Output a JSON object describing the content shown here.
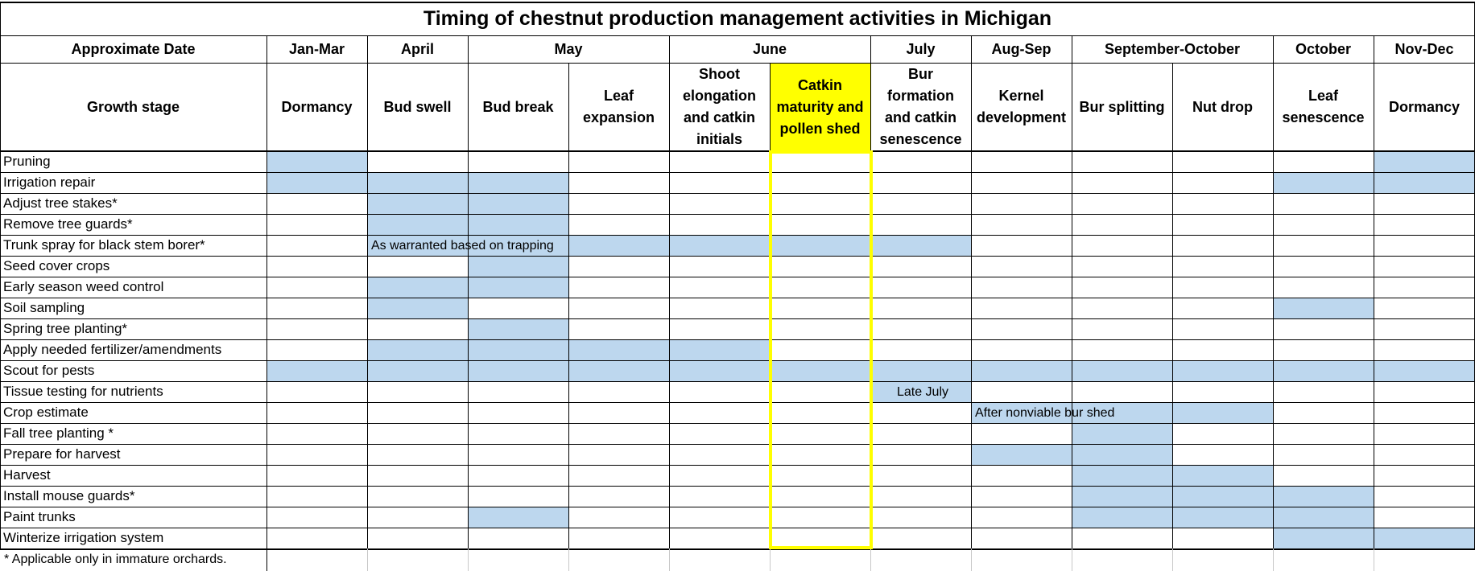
{
  "sheet_title": "Timing of chestnut production management activities in Michigan",
  "date_header": "Approximate Date",
  "dates": [
    "Jan-Mar",
    "April",
    "May",
    "June",
    "July",
    "Aug-Sep",
    "September-October",
    "October",
    "Nov-Dec"
  ],
  "stage_header": "Growth stage",
  "stages": [
    "Dormancy",
    "Bud swell",
    "Bud break",
    "Leaf\nexpansion",
    "Shoot\nelongation\nand catkin\ninitials",
    "Catkin\nmaturity and\npollen shed",
    "Bur\nformation\nand catkin\nsenescence",
    "Kernel\ndevelopment",
    "Bur splitting",
    "Nut drop",
    "Leaf\nsenescence",
    "Dormancy"
  ],
  "highlight_color": "#ffff00",
  "bar_color": "#bdd7ee",
  "activities": [
    {
      "name": "Pruning",
      "spans": [
        {
          "start": 0,
          "end": 0
        },
        {
          "start": 11,
          "end": 11
        }
      ]
    },
    {
      "name": "Irrigation repair",
      "spans": [
        {
          "start": 0,
          "end": 2
        },
        {
          "start": 10,
          "end": 11
        }
      ]
    },
    {
      "name": "Adjust tree stakes*",
      "spans": [
        {
          "start": 1,
          "end": 2
        }
      ]
    },
    {
      "name": "Remove tree guards*",
      "spans": [
        {
          "start": 1,
          "end": 2
        }
      ]
    },
    {
      "name": "Trunk spray for black stem borer*",
      "spans": [
        {
          "start": 1,
          "end": 6,
          "label": "As warranted based on trapping"
        }
      ]
    },
    {
      "name": "Seed cover crops",
      "spans": [
        {
          "start": 2,
          "end": 2
        }
      ]
    },
    {
      "name": "Early season weed control",
      "spans": [
        {
          "start": 1,
          "end": 2
        }
      ]
    },
    {
      "name": "Soil sampling",
      "spans": [
        {
          "start": 1,
          "end": 1
        },
        {
          "start": 10,
          "end": 10
        }
      ]
    },
    {
      "name": "Spring tree planting*",
      "spans": [
        {
          "start": 2,
          "end": 2
        }
      ]
    },
    {
      "name": "Apply needed fertilizer/amendments",
      "spans": [
        {
          "start": 1,
          "end": 4
        }
      ]
    },
    {
      "name": "Scout for pests",
      "spans": [
        {
          "start": 0,
          "end": 11
        }
      ]
    },
    {
      "name": "Tissue testing for nutrients",
      "spans": [
        {
          "start": 6,
          "end": 6,
          "label": "Late July"
        }
      ]
    },
    {
      "name": "Crop estimate",
      "spans": [
        {
          "start": 7,
          "end": 9,
          "label": "After nonviable bur shed"
        }
      ]
    },
    {
      "name": "Fall tree planting *",
      "spans": [
        {
          "start": 8,
          "end": 8
        }
      ]
    },
    {
      "name": "Prepare for harvest",
      "spans": [
        {
          "start": 7,
          "end": 8
        }
      ]
    },
    {
      "name": "Harvest",
      "spans": [
        {
          "start": 8,
          "end": 9
        }
      ]
    },
    {
      "name": "Install mouse guards*",
      "spans": [
        {
          "start": 8,
          "end": 10
        }
      ]
    },
    {
      "name": "Paint trunks",
      "spans": [
        {
          "start": 2,
          "end": 2
        },
        {
          "start": 8,
          "end": 10
        }
      ]
    },
    {
      "name": "Winterize irrigation system",
      "spans": [
        {
          "start": 10,
          "end": 11
        }
      ]
    }
  ],
  "footnote": "* Applicable only in immature orchards."
}
